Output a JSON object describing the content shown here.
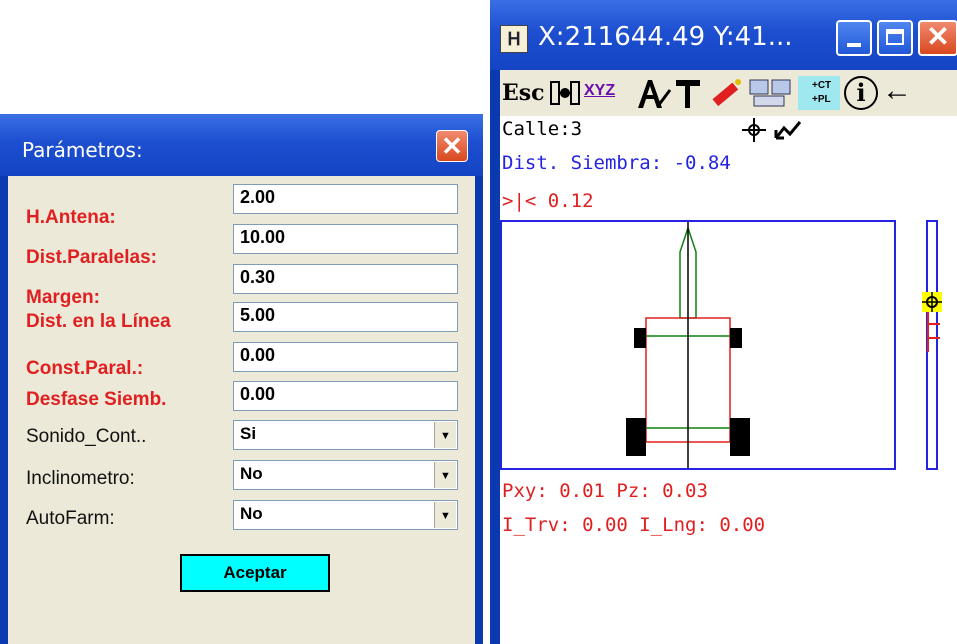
{
  "params_dialog": {
    "title": "Parámetros:",
    "fields": [
      {
        "label": "H.Antena:",
        "value": "2.00"
      },
      {
        "label": "Dist.Paralelas:",
        "value": "10.00"
      },
      {
        "label": "Margen:",
        "value": "0.30"
      },
      {
        "label": "Dist. en la Línea",
        "value": "5.00"
      },
      {
        "label": "Const.Paral.:",
        "value": "0.00"
      },
      {
        "label": "Desfase Siemb.",
        "value": "0.00"
      }
    ],
    "selects": [
      {
        "label": "Sonido_Cont..",
        "value": "Si"
      },
      {
        "label": "Inclinometro:",
        "value": "No"
      },
      {
        "label": "AutoFarm:",
        "value": "No"
      }
    ],
    "accept_label": "Aceptar",
    "label_color": "#e02020"
  },
  "app_window": {
    "title": "X:211644.49 Y:41...",
    "toolbar": {
      "esc_label": "Esc",
      "xyz_label": "XYZ",
      "ctpl_label_1": "+CT",
      "ctpl_label_2": "+PL",
      "info_label": "i"
    },
    "calle": "Calle:3",
    "dist_siembra": "Dist. Siembra: -0.84",
    "offset": ">|<  0.12",
    "pxy_pz": "Pxy: 0.01 Pz:   0.03",
    "inclination": "I_Trv: 0.00 I_Lng: 0.00",
    "colors": {
      "blue_text": "#2424e0",
      "red_text": "#e02020",
      "tractor_green": "#108010",
      "tractor_red": "#e02020"
    }
  }
}
